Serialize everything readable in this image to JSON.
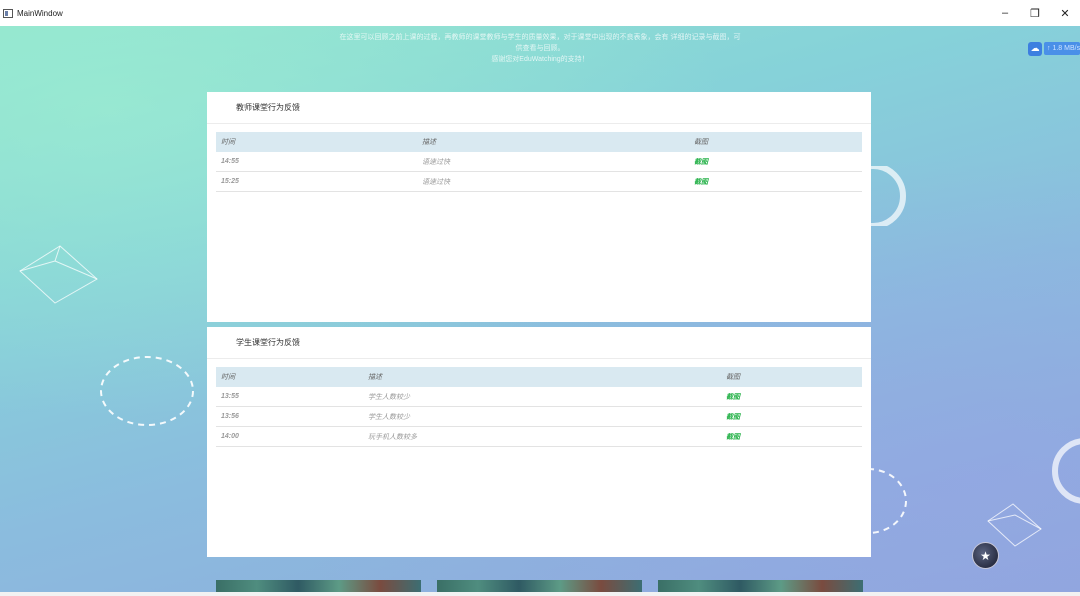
{
  "window": {
    "title": "MainWindow",
    "minimize_glyph": "–",
    "restore_glyph": "❐",
    "close_glyph": "✕"
  },
  "intro": {
    "line1": "在这里可以回顾之前上课的过程，再教师的课堂教师与学生的质量效果，对于课堂中出现的不良表象，会有 详细的记录与截图，可",
    "line2": "供查看与回顾。",
    "line3": "感谢您对EduWatching的支持！"
  },
  "speed_badge": {
    "icon": "cloud-icon",
    "text": "↑ 1.8 MB/s"
  },
  "teacher_panel": {
    "title": "教师课堂行为反馈",
    "columns": [
      "时间",
      "描述",
      "截图"
    ],
    "rows": [
      [
        "14:55",
        "语速过快",
        "截图"
      ],
      [
        "15:25",
        "语速过快",
        "截图"
      ]
    ]
  },
  "student_panel": {
    "title": "学生课堂行为反馈",
    "columns": [
      "时间",
      "描述",
      "截图"
    ],
    "rows": [
      [
        "13:55",
        "学生人数较少",
        "截图"
      ],
      [
        "13:56",
        "学生人数较少",
        "截图"
      ],
      [
        "14:00",
        "玩手机人数较多",
        "截图"
      ]
    ]
  },
  "colors": {
    "header_row": "#d9e9f1",
    "screenshot_link": "#27b24a",
    "background_start": "#8fe3cf",
    "background_end": "#8fa8dc"
  }
}
